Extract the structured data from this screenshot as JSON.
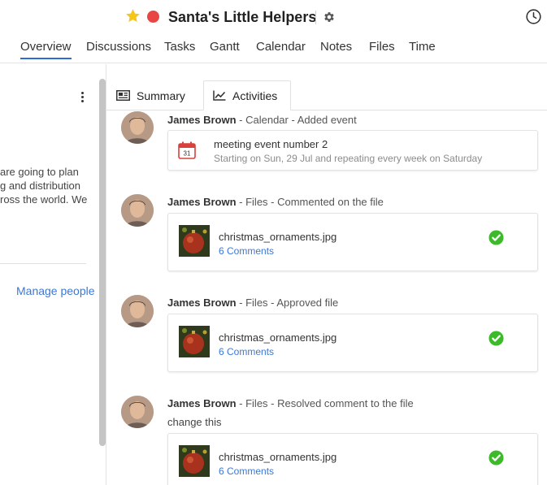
{
  "header": {
    "project_title": "Santa's Little Helpers",
    "status_color": "#e84545",
    "star_color": "#f5c518",
    "icons": [
      "star-icon",
      "status-dot",
      "gear-icon",
      "clock-icon"
    ]
  },
  "nav": {
    "tabs": [
      {
        "label": "Overview",
        "active": true
      },
      {
        "label": "Discussions"
      },
      {
        "label": "Tasks"
      },
      {
        "label": "Gantt"
      },
      {
        "label": "Calendar"
      },
      {
        "label": "Notes"
      },
      {
        "label": "Files"
      },
      {
        "label": "Time"
      }
    ]
  },
  "left": {
    "description_lines": [
      "are going to plan",
      "g and distribution",
      "ross the world. We"
    ],
    "manage_people": "Manage people"
  },
  "subtabs": [
    {
      "label": "Summary",
      "icon": "newspaper-icon"
    },
    {
      "label": "Activities",
      "icon": "line-chart-icon",
      "active": true
    }
  ],
  "activities": [
    {
      "user": "James Brown",
      "action": " - Calendar - Added event",
      "card": {
        "type": "event",
        "title": "meeting event number 2",
        "subtitle": "Starting on Sun, 29 Jul and repeating every week on Saturday",
        "calendar_day": "31"
      }
    },
    {
      "user": "James Brown",
      "action": " - Files - Commented on the file",
      "card": {
        "type": "file",
        "filename": "christmas_ornaments.jpg",
        "comments": "6 Comments",
        "approved": true
      }
    },
    {
      "user": "James Brown",
      "action": " - Files - Approved file",
      "card": {
        "type": "file",
        "filename": "christmas_ornaments.jpg",
        "comments": "6 Comments",
        "approved": true
      }
    },
    {
      "user": "James Brown",
      "action": " - Files - Resolved comment to the file",
      "note": "change this",
      "card": {
        "type": "file",
        "filename": "christmas_ornaments.jpg",
        "comments": "6 Comments",
        "approved": true
      }
    }
  ],
  "colors": {
    "accent": "#2d6bd6",
    "link": "#3a78d8",
    "approved": "#3cba2a",
    "calendar_red": "#d9413a"
  }
}
